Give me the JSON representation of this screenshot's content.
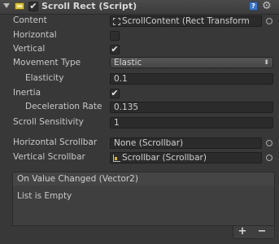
{
  "header": {
    "title": "Scroll Rect (Script)",
    "enabled": "✔",
    "help": "?",
    "gear": "⚙"
  },
  "fields": {
    "content_label": "Content",
    "content_value": "ScrollContent (Rect Transform",
    "horizontal_label": "Horizontal",
    "vertical_label": "Vertical",
    "vertical_check": "✔",
    "movement_type_label": "Movement Type",
    "movement_type_value": "Elastic",
    "dropdown_arrow": "⬍",
    "elasticity_label": "Elasticity",
    "elasticity_value": "0.1",
    "inertia_label": "Inertia",
    "inertia_check": "✔",
    "deceleration_label": "Deceleration Rate",
    "deceleration_value": "0.135",
    "scroll_sensitivity_label": "Scroll Sensitivity",
    "scroll_sensitivity_value": "1",
    "h_scrollbar_label": "Horizontal Scrollbar",
    "h_scrollbar_value": "None (Scrollbar)",
    "v_scrollbar_label": "Vertical Scrollbar",
    "v_scrollbar_value": "Scrollbar (Scrollbar)"
  },
  "event": {
    "header": "On Value Changed (Vector2)",
    "empty": "List is Empty",
    "add": "+",
    "remove": "−"
  }
}
